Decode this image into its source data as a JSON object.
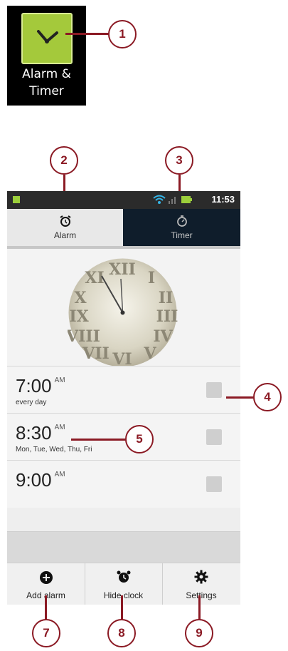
{
  "app_icon": {
    "label_line1": "Alarm &",
    "label_line2": "Timer",
    "icon": "alarm-clock-icon",
    "color": "#a4c93b"
  },
  "status_bar": {
    "time": "11:53",
    "icons": [
      "usb-icon",
      "wifi-icon",
      "signal-icon",
      "battery-icon"
    ]
  },
  "tabs": [
    {
      "label": "Alarm",
      "icon": "alarm-icon"
    },
    {
      "label": "Timer",
      "icon": "stopwatch-icon"
    }
  ],
  "alarms": [
    {
      "time": "7:00",
      "ampm": "AM",
      "days": "every day",
      "checked": false
    },
    {
      "time": "8:30",
      "ampm": "AM",
      "days": "Mon, Tue, Wed, Thu, Fri",
      "checked": false
    },
    {
      "time": "9:00",
      "ampm": "AM",
      "days": "",
      "checked": false
    }
  ],
  "bottom_bar": {
    "add": {
      "label": "Add alarm",
      "icon": "add-circle-icon"
    },
    "hide": {
      "label": "Hide clock",
      "icon": "alarm-clock-icon"
    },
    "settings": {
      "label": "Settings",
      "icon": "gear-icon"
    }
  },
  "callouts": [
    "1",
    "2",
    "3",
    "4",
    "5",
    "7",
    "8",
    "9"
  ],
  "colors": {
    "callout": "#8b1a24",
    "timer_tab": "#0f1d2b"
  }
}
